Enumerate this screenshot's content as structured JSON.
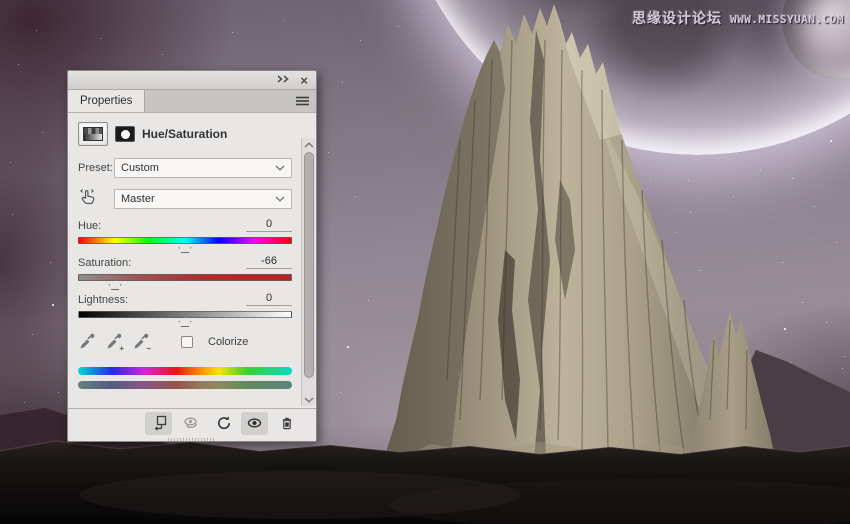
{
  "watermark": {
    "forum_name": "思缘设计论坛",
    "site_url": "WWW.MISSYUAN.COM"
  },
  "properties_panel": {
    "window_icons": {
      "collapse": "collapse-to-icons",
      "close": "×",
      "menu": "panel-menu"
    },
    "tab_label": "Properties",
    "adjustment_title": "Hue/Saturation",
    "preset": {
      "label": "Preset:",
      "value": "Custom"
    },
    "channel": {
      "value": "Master"
    },
    "sliders": [
      {
        "label": "Hue:",
        "value": "0",
        "thumb_pct": 50
      },
      {
        "label": "Saturation:",
        "value": "-66",
        "thumb_pct": 17
      },
      {
        "label": "Lightness:",
        "value": "0",
        "thumb_pct": 50
      }
    ],
    "colorize": {
      "label": "Colorize",
      "checked": false
    },
    "footer_buttons": [
      "clip-to-layer",
      "view-previous-state",
      "reset",
      "toggle-visibility",
      "delete"
    ],
    "colors": {
      "hue_track": [
        "#ff0000",
        "#ffff00",
        "#00ff00",
        "#00ffff",
        "#0000ff",
        "#ff00ff",
        "#ff0000"
      ],
      "saturation_track": [
        "#8e8e8e",
        "#bd1f1f"
      ],
      "lightness_track": [
        "#000000",
        "#7f7f7f",
        "#ffffff"
      ],
      "spectrum_before": [
        "#00ddcf",
        "#2626f0",
        "#d924d9",
        "#f01212",
        "#ff8c00",
        "#f5e500",
        "#3ecf2e",
        "#00ddc4"
      ],
      "spectrum_after": [
        "#64827d",
        "#565a83",
        "#855883",
        "#95524c",
        "#93795a",
        "#8f8a5e",
        "#5e8a5c",
        "#5d837c"
      ]
    }
  }
}
